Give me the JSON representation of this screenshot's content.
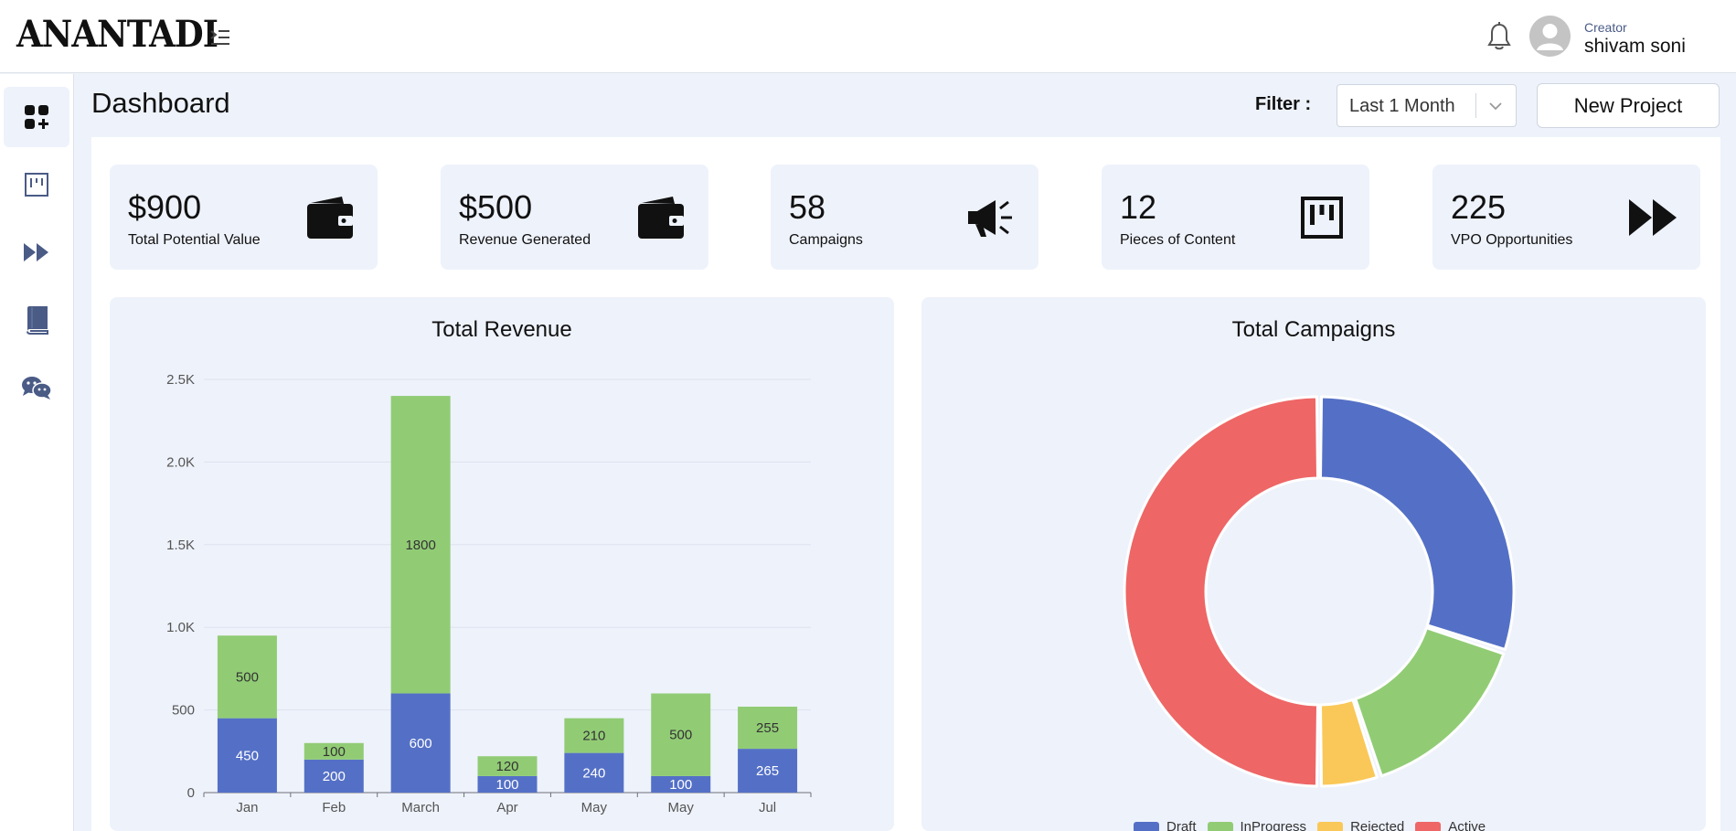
{
  "app": {
    "logo": "ANANTADI"
  },
  "user": {
    "role": "Creator",
    "name": "shivam soni"
  },
  "page": {
    "title": "Dashboard"
  },
  "filter": {
    "label": "Filter  :",
    "value": "Last 1 Month"
  },
  "actions": {
    "new_project": "New Project"
  },
  "sidebar": {
    "items": [
      {
        "icon": "dashboard-add-icon",
        "active": true
      },
      {
        "icon": "kanban-board-icon",
        "active": false
      },
      {
        "icon": "fast-forward-icon",
        "active": false
      },
      {
        "icon": "book-icon",
        "active": false
      },
      {
        "icon": "chat-bubbles-icon",
        "active": false
      }
    ]
  },
  "cards": [
    {
      "value": "$900",
      "label": "Total Potential Value",
      "icon": "wallet-icon"
    },
    {
      "value": "$500",
      "label": "Revenue Generated",
      "icon": "wallet-icon"
    },
    {
      "value": "58",
      "label": "Campaigns",
      "icon": "megaphone-icon"
    },
    {
      "value": "12",
      "label": "Pieces of Content",
      "icon": "kanban-board-icon"
    },
    {
      "value": "225",
      "label": "VPO Opportunities",
      "icon": "fast-forward-icon"
    }
  ],
  "colors": {
    "blue": "#5470c6",
    "green": "#91cc75",
    "yellow": "#fac858",
    "red": "#ee6666"
  },
  "chart_data": [
    {
      "type": "bar",
      "title": "Total Revenue",
      "stacked": true,
      "categories": [
        "Jan",
        "Feb",
        "March",
        "Apr",
        "May",
        "May",
        "Jul"
      ],
      "series": [
        {
          "color": "#5470c6",
          "values": [
            450,
            200,
            600,
            100,
            240,
            100,
            265
          ]
        },
        {
          "color": "#91cc75",
          "values": [
            500,
            100,
            1800,
            120,
            210,
            500,
            255
          ]
        }
      ],
      "ylim": [
        0,
        2500
      ],
      "yticks": [
        "0",
        "500",
        "1.0K",
        "1.5K",
        "2.0K",
        "2.5K"
      ],
      "grid": true
    },
    {
      "type": "pie",
      "title": "Total Campaigns",
      "donut": true,
      "labels": [
        "Draft",
        "InProgress",
        "Rejected",
        "Active"
      ],
      "values": [
        30,
        15,
        5,
        50
      ],
      "colors": [
        "#5470c6",
        "#91cc75",
        "#fac858",
        "#ee6666"
      ],
      "legend": "bottom"
    }
  ]
}
